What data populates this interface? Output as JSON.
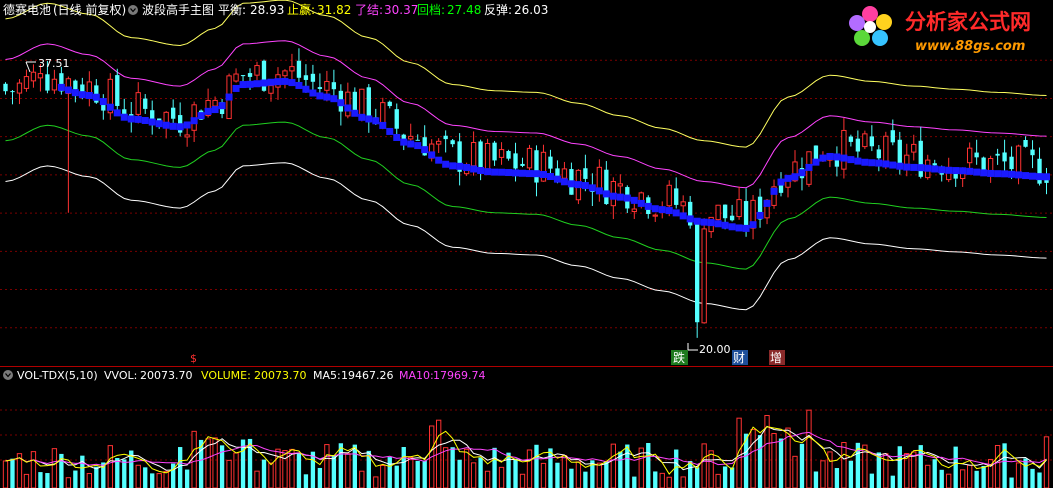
{
  "header": {
    "stock_name": "德赛电池",
    "adjust_mode": "(日线 前复权)",
    "indicator_name": "波段高手主图",
    "items": [
      {
        "label": "平衡:",
        "value": "28.93",
        "label_color": "#ffffff",
        "value_color": "#ffffff"
      },
      {
        "label": "止赢:",
        "value": "31.82",
        "label_color": "#ffff00",
        "value_color": "#ffff00"
      },
      {
        "label": "了结:",
        "value": "30.37",
        "label_color": "#ff44ff",
        "value_color": "#ff44ff"
      },
      {
        "label": "回档:",
        "value": "27.48",
        "label_color": "#00ff00",
        "value_color": "#00ff00"
      },
      {
        "label": "反弹:",
        "value": "26.03",
        "label_color": "#ffffff",
        "value_color": "#ffffff"
      }
    ]
  },
  "watermark": {
    "brand": "分析家公式网",
    "url": "www.88gs.com"
  },
  "price_annotations": {
    "high_label": "37.51",
    "low_label": "20.00"
  },
  "event_markers": [
    {
      "text": "$",
      "color": "#ff3030",
      "bg": "transparent"
    },
    {
      "text": "跌",
      "color": "#ffffff",
      "bg": "#1e7a1e"
    },
    {
      "text": "财",
      "color": "#ffffff",
      "bg": "#1e4f9a"
    },
    {
      "text": "增",
      "color": "#ffffff",
      "bg": "#8a2a2a"
    }
  ],
  "volume_header": {
    "indicator": "VOL-TDX(5,10)",
    "items": [
      {
        "label": "VVOL:",
        "value": "20073.70",
        "color": "#ffffff"
      },
      {
        "label": "VOLUME:",
        "value": "20073.70",
        "color": "#ffff00"
      },
      {
        "label": "MA5:",
        "value": "19467.26",
        "color": "#ffffff"
      },
      {
        "label": "MA10:",
        "value": "17969.74",
        "color": "#ff44ff"
      }
    ]
  },
  "colors": {
    "up": "#ff3232",
    "down": "#54ffff",
    "balance_dots": "#1a1aff",
    "take_profit": "#ffff60",
    "close_out": "#ff44ff",
    "pullback": "#20d020",
    "rebound": "#ffffff",
    "grid": "#7a0000",
    "vol_ma5": "#ffffff",
    "vol_ma10": "#ff44ff",
    "vol_line": "#ffff00"
  },
  "chart_data": {
    "type": "candlestick",
    "price_ylim": [
      18.2,
      40.2
    ],
    "high": 37.51,
    "low": 20.0,
    "balance_anchors": [
      [
        0,
        35.2
      ],
      [
        6,
        36.2
      ],
      [
        12,
        35.5
      ],
      [
        18,
        34.0
      ],
      [
        25,
        33.5
      ],
      [
        30,
        34.6
      ],
      [
        34,
        36.2
      ],
      [
        40,
        36.4
      ],
      [
        46,
        35.4
      ],
      [
        52,
        34.0
      ],
      [
        58,
        32.4
      ],
      [
        64,
        31.0
      ],
      [
        70,
        30.6
      ],
      [
        76,
        30.5
      ],
      [
        82,
        29.8
      ],
      [
        88,
        29.0
      ],
      [
        94,
        28.2
      ],
      [
        100,
        27.4
      ],
      [
        106,
        27.0
      ],
      [
        112,
        30.2
      ],
      [
        118,
        31.6
      ],
      [
        124,
        31.2
      ],
      [
        130,
        30.9
      ],
      [
        136,
        30.7
      ],
      [
        142,
        30.5
      ],
      [
        149,
        30.3
      ]
    ],
    "take_profit_offset": 5.2,
    "close_out_offset": 2.6,
    "pullback_offset": -2.6,
    "rebound_offset": -5.2,
    "candle_count": 150,
    "volume_max": 40000,
    "volume_last": 20073.7,
    "volume_ma5_last": 19467.26,
    "volume_ma10_last": 17969.74
  }
}
